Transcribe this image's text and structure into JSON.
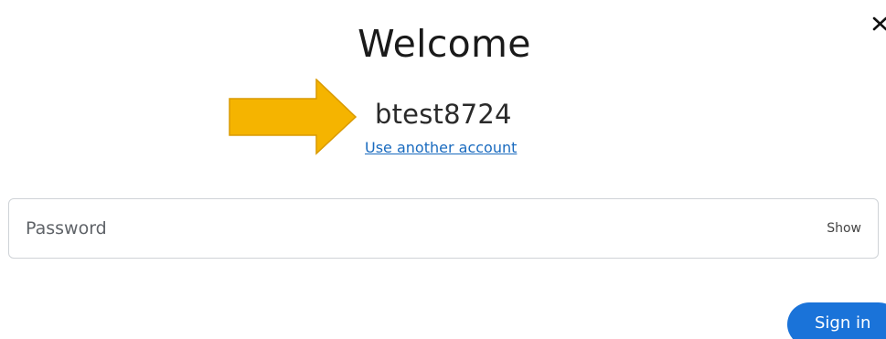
{
  "dialog": {
    "title": "Welcome",
    "username": "btest8724",
    "use_another_account": "Use another account"
  },
  "password_field": {
    "placeholder": "Password",
    "value": "",
    "show_label": "Show"
  },
  "actions": {
    "sign_in_label": "Sign in"
  },
  "icons": {
    "close": "close-icon",
    "annotation_arrow": "arrow-right-icon"
  },
  "colors": {
    "accent": "#1a73d9",
    "link": "#1a6bbf",
    "arrow_fill": "#f5b400",
    "arrow_stroke": "#d99a00"
  }
}
